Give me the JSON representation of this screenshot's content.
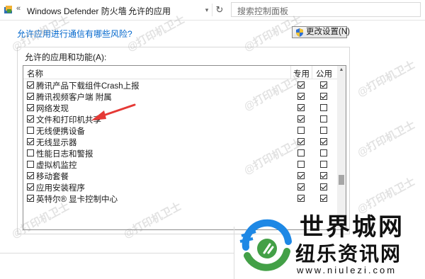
{
  "address_bar": {
    "back_arrows": "«",
    "crumbs": [
      "Windows Defender 防火墙",
      "允许的应用"
    ],
    "separator": "›",
    "dropdown_glyph": "▾",
    "refresh_glyph": "↻",
    "search_placeholder": "搜索控制面板"
  },
  "content": {
    "risk_link": "允许应用进行通信有哪些风险?",
    "change_settings_button": "更改设置(N)",
    "group_label": "允许的应用和功能(A):",
    "columns": {
      "name": "名称",
      "private": "专用",
      "public": "公用"
    },
    "rows": [
      {
        "name": "腾讯产品下载组件Crash上报",
        "enabled": true,
        "private": true,
        "public": true
      },
      {
        "name": "腾讯视频客户端 附属",
        "enabled": true,
        "private": true,
        "public": true
      },
      {
        "name": "网络发现",
        "enabled": true,
        "private": true,
        "public": false
      },
      {
        "name": "文件和打印机共享",
        "enabled": true,
        "private": true,
        "public": false
      },
      {
        "name": "无线便携设备",
        "enabled": false,
        "private": false,
        "public": false
      },
      {
        "name": "无线显示器",
        "enabled": true,
        "private": true,
        "public": true
      },
      {
        "name": "性能日志和警报",
        "enabled": false,
        "private": false,
        "public": false
      },
      {
        "name": "虚拟机监控",
        "enabled": false,
        "private": false,
        "public": false
      },
      {
        "name": "移动套餐",
        "enabled": true,
        "private": true,
        "public": true
      },
      {
        "name": "应用安装程序",
        "enabled": true,
        "private": true,
        "public": true
      },
      {
        "name": "英特尔® 显卡控制中心",
        "enabled": true,
        "private": true,
        "public": true
      }
    ]
  },
  "watermark_text": "@打印机卫士",
  "logo": {
    "top_text": "世界城网",
    "cn_text": "纽乐资讯网",
    "url": "www.niulezi.com",
    "colors": {
      "ring_blue": "#1e88e5",
      "ring_green": "#43a047"
    }
  },
  "colors": {
    "link": "#0066cc",
    "arrow": "#e53935"
  }
}
